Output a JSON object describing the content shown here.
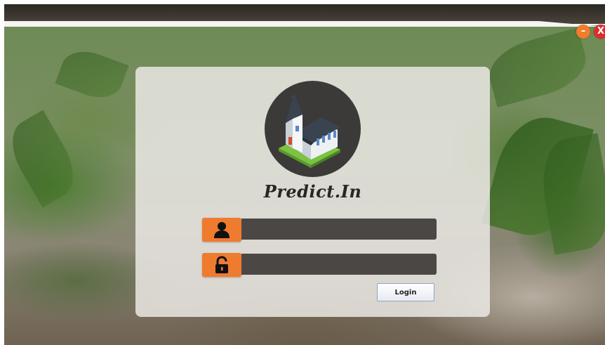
{
  "window": {
    "minimize_symbol": "–",
    "close_symbol": "X"
  },
  "app": {
    "brand_name": "Predict.In",
    "logo_icon": "church-icon"
  },
  "form": {
    "username": {
      "icon": "user-icon",
      "value": "",
      "placeholder": ""
    },
    "password": {
      "icon": "padlock-icon",
      "value": "",
      "placeholder": ""
    },
    "login_label": "Login"
  },
  "colors": {
    "accent_orange": "#ef7b2e",
    "close_red": "#e22b2b",
    "input_dark": "#4b4745",
    "logo_circle": "#3c3a38"
  }
}
